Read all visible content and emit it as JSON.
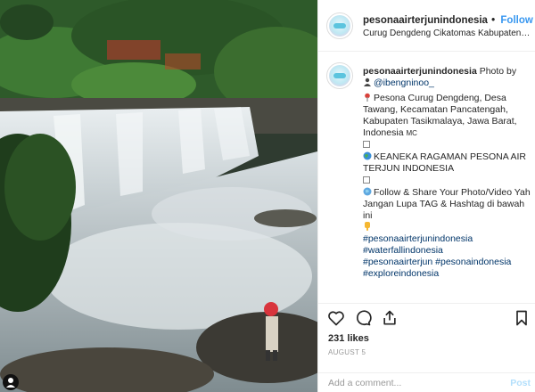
{
  "header": {
    "username": "pesonaairterjunindonesia",
    "separator": "•",
    "follow_label": "Follow",
    "location": "Curug Dengdeng Cikatomas Kabupaten Tasikmalaya",
    "avatar_icon": "brand-logo-icon"
  },
  "caption": {
    "username": "pesonaairterjunindonesia",
    "intro": "Photo by",
    "photographer": "@ibengninoo_",
    "location_text": "Pesona Curug Dengdeng, Desa Tawang, Kecamatan Pancatengah, Kabupaten Tasikmalaya, Jawa Barat, Indonesia",
    "location_suffix": "MC",
    "headline": "KEANEKA RAGAMAN PESONA AIR TERJUN INDONESIA",
    "share_text": "Follow & Share Your Photo/Video Yah Jangan Lupa TAG & Hashtag di bawah ini",
    "hashtags": [
      "#pesonaairterjunindonesia",
      "#waterfallindonesia",
      "#pesonaairterjun #pesonaindonesia",
      "#exploreindonesia"
    ]
  },
  "actions": {
    "icons": [
      "heart-icon",
      "comment-icon",
      "share-icon",
      "bookmark-icon"
    ]
  },
  "likes": "231 likes",
  "date": "AUGUST 5",
  "comment": {
    "placeholder": "Add a comment...",
    "post_label": "Post"
  },
  "colors": {
    "link": "#3897f0",
    "hashtag": "#003569",
    "post_disabled": "#b2dffc"
  }
}
